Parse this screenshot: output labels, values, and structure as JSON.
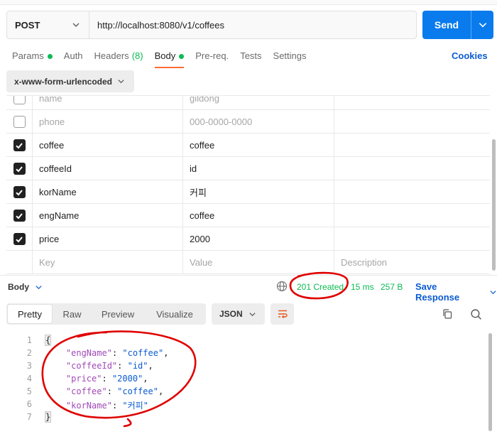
{
  "request": {
    "method": "POST",
    "url": "http://localhost:8080/v1/coffees",
    "send_label": "Send"
  },
  "tabs": [
    {
      "label": "Params",
      "dot": true
    },
    {
      "label": "Auth"
    },
    {
      "label": "Headers",
      "count": "(8)"
    },
    {
      "label": "Body",
      "dot": true,
      "active": true
    },
    {
      "label": "Pre-req."
    },
    {
      "label": "Tests"
    },
    {
      "label": "Settings"
    }
  ],
  "cookies_label": "Cookies",
  "body_type": "x-www-form-urlencoded",
  "form_rows": [
    {
      "key": "name",
      "value": "gildong",
      "checked": false
    },
    {
      "key": "phone",
      "value": "000-0000-0000",
      "checked": false
    },
    {
      "key": "coffee",
      "value": "coffee",
      "checked": true
    },
    {
      "key": "coffeeId",
      "value": "id",
      "checked": true
    },
    {
      "key": "korName",
      "value": "커피",
      "checked": true
    },
    {
      "key": "engName",
      "value": "coffee",
      "checked": true
    },
    {
      "key": "price",
      "value": "2000",
      "checked": true
    }
  ],
  "form_placeholders": {
    "key": "Key",
    "value": "Value",
    "description": "Description"
  },
  "response": {
    "section_label": "Body",
    "status": "201 Created",
    "time": "15 ms",
    "size": "257 B",
    "save_label": "Save Response",
    "view_tabs": [
      "Pretty",
      "Raw",
      "Preview",
      "Visualize"
    ],
    "active_view": "Pretty",
    "format": "JSON",
    "code_lines": [
      "{",
      "    \"engName\": \"coffee\",",
      "    \"coffeeId\": \"id\",",
      "    \"price\": \"2000\",",
      "    \"coffee\": \"coffee\",",
      "    \"korName\": \"커피\"",
      "}"
    ],
    "line_numbers": [
      "1",
      "2",
      "3",
      "4",
      "5",
      "6",
      "7"
    ]
  },
  "colors": {
    "send": "#097bed",
    "active_tab_underline": "#ff6c37",
    "status_green": "#0cbb52",
    "link_blue": "#0b5bd0",
    "annotation_red": "#e00000"
  },
  "icons": {
    "method_dropdown": "chevron-down-icon",
    "send_dropdown": "chevron-down-icon",
    "checkbox": "check-icon",
    "network": "globe-icon",
    "wrap": "wrap-lines-icon",
    "copy": "copy-icon",
    "search": "search-icon"
  }
}
